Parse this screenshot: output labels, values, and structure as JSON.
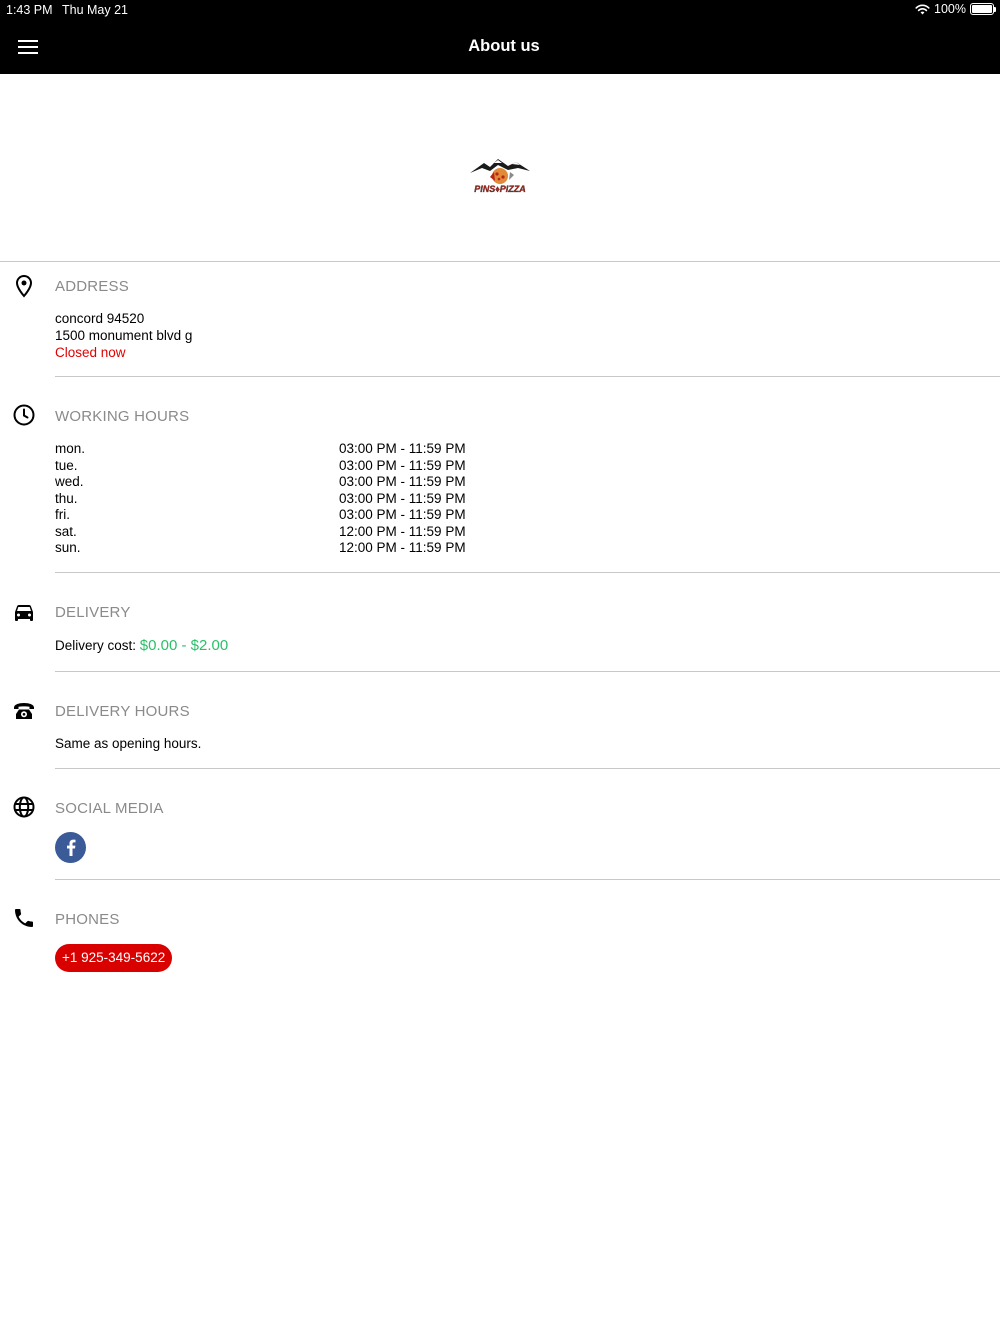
{
  "status_bar": {
    "time": "1:43 PM",
    "date": "Thu May 21",
    "battery": "100%"
  },
  "header": {
    "title": "About us"
  },
  "logo": {
    "icon": "pins-pizza-logo"
  },
  "address": {
    "title": "ADDRESS",
    "line1": "concord 94520",
    "line2": "1500 monument blvd g",
    "status": "Closed now"
  },
  "working_hours": {
    "title": "WORKING HOURS",
    "rows": [
      {
        "day": "mon.",
        "time": "03:00 PM - 11:59 PM"
      },
      {
        "day": "tue.",
        "time": "03:00 PM - 11:59 PM"
      },
      {
        "day": "wed.",
        "time": "03:00 PM - 11:59 PM"
      },
      {
        "day": "thu.",
        "time": "03:00 PM - 11:59 PM"
      },
      {
        "day": "fri.",
        "time": "03:00 PM - 11:59 PM"
      },
      {
        "day": "sat.",
        "time": "12:00 PM - 11:59 PM"
      },
      {
        "day": "sun.",
        "time": "12:00 PM - 11:59 PM"
      }
    ]
  },
  "delivery": {
    "title": "DELIVERY",
    "cost_label": "Delivery cost:",
    "cost_value": "$0.00 - $2.00"
  },
  "delivery_hours": {
    "title": "DELIVERY HOURS",
    "text": "Same as opening hours."
  },
  "social_media": {
    "title": "SOCIAL MEDIA",
    "facebook_icon": "facebook-icon"
  },
  "phones": {
    "title": "PHONES",
    "number": "+1 925-349-5622"
  },
  "colors": {
    "header_bg": "#000000",
    "closed_red": "#e00000",
    "price_green": "#2bbf6a",
    "facebook_blue": "#3a5a98",
    "phone_red": "#d90000",
    "section_title_gray": "#8a8a8a"
  }
}
